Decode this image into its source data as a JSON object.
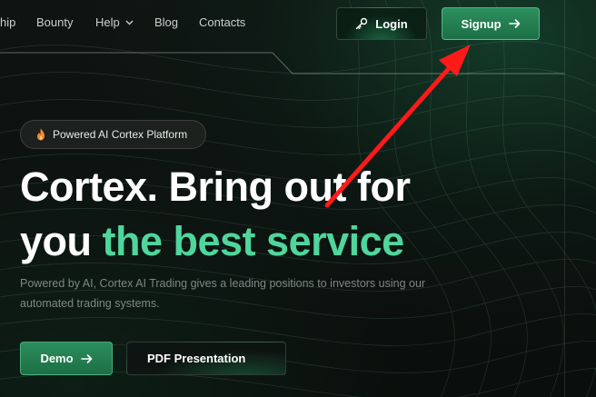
{
  "nav": {
    "links": [
      {
        "label": "hip"
      },
      {
        "label": "Bounty"
      },
      {
        "label": "Help"
      },
      {
        "label": "Blog"
      },
      {
        "label": "Contacts"
      }
    ],
    "login_label": "Login",
    "signup_label": "Signup"
  },
  "hero": {
    "badge": "Powered AI Cortex Platform",
    "headline_line1": "Cortex. Bring out for",
    "headline_line2_prefix": "you ",
    "headline_line2_accent": "the best service",
    "subtitle": "Powered by AI, Cortex AI Trading gives a leading positions to investors using our automated trading systems.",
    "demo_label": "Demo",
    "pdf_label": "PDF Presentation"
  },
  "icons": {
    "login": "key-icon",
    "signup": "arrow-right-icon",
    "badge": "flame-icon",
    "help": "chevron-down-icon",
    "demo": "arrow-right-icon"
  },
  "colors": {
    "accent": "#4fd69c",
    "primary_button": "#2c8f5e",
    "annotation_arrow": "#ff1a1a"
  }
}
